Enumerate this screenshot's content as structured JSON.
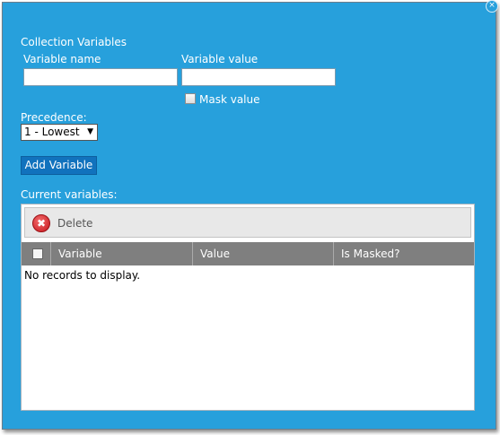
{
  "dialog": {
    "close_glyph": "×"
  },
  "form": {
    "section_title": "Collection Variables",
    "name_label": "Variable name",
    "name_value": "",
    "value_label": "Variable value",
    "value_value": "",
    "mask_label": "Mask value",
    "mask_checked": false,
    "precedence_label": "Precedence:",
    "precedence_selected": "1 - Lowest",
    "add_button": "Add Variable"
  },
  "grid": {
    "caption": "Current variables:",
    "delete_label": "Delete",
    "delete_glyph": "✖",
    "columns": [
      "Variable",
      "Value",
      "Is Masked?"
    ],
    "empty_message": "No records to display."
  },
  "colors": {
    "dialog_bg": "#27a0dc",
    "button_bg": "#1172bd",
    "header_bg": "#7f7f7f",
    "delete_red": "#c8161d"
  }
}
